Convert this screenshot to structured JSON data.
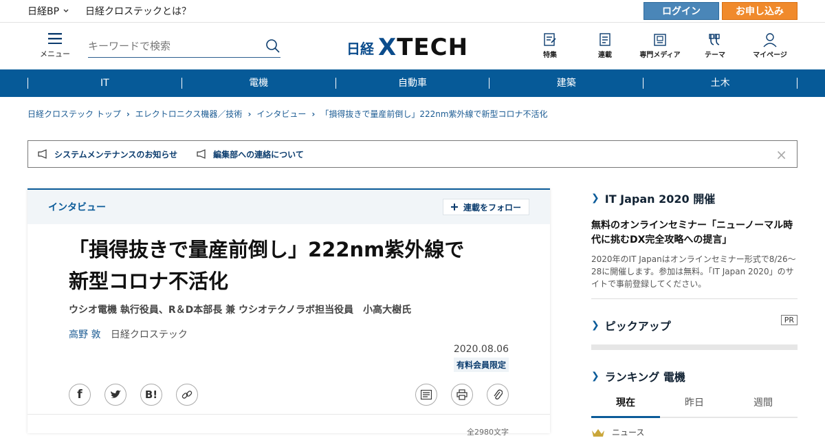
{
  "topbar": {
    "brand": "日経BP",
    "about": "日経クロステックとは？",
    "login": "ログイン",
    "signup": "お申し込み"
  },
  "header": {
    "menu_label": "メニュー",
    "search_placeholder": "キーワードで検索",
    "logo_nikkei": "日経",
    "logo_x": "X",
    "logo_tech": "TECH",
    "nav": [
      {
        "label": "特集",
        "icon": "feature-icon"
      },
      {
        "label": "連載",
        "icon": "series-icon"
      },
      {
        "label": "専門メディア",
        "icon": "media-icon"
      },
      {
        "label": "テーマ",
        "icon": "theme-icon"
      },
      {
        "label": "マイページ",
        "icon": "user-icon"
      }
    ]
  },
  "categories": [
    "IT",
    "電機",
    "自動車",
    "建築",
    "土木"
  ],
  "breadcrumb": [
    "日経クロステック トップ",
    "エレクトロニクス機器／技術",
    "インタビュー",
    "「損得抜きで量産前倒し」222nm紫外線で新型コロナ不活化"
  ],
  "notices": [
    "システムメンテナンスのお知らせ",
    "編集部への連絡について"
  ],
  "notice_close": "×",
  "article": {
    "category": "インタビュー",
    "follow": "連載をフォロー",
    "title_line1": "「損得抜きで量産前倒し」222nm紫外線で",
    "title_line2": "新型コロナ不活化",
    "subtitle": "ウシオ電機 執行役員、R＆D本部長 兼 ウシオテクノラボ担当役員　小高大樹氏",
    "author_name": "高野 敦",
    "author_org": "日経クロステック",
    "date": "2020.08.06",
    "member_only": "有料会員限定",
    "char_count": "全2980文字"
  },
  "sidebar": {
    "event_heading": "IT Japan 2020 開催",
    "promo_title": "無料のオンラインセミナー「ニューノーマル時代に挑むDX完全攻略への提言」",
    "promo_text": "2020年のIT Japanはオンラインセミナー形式で8/26～28に開催します。参加は無料。「IT Japan 2020」のサイトで事前登録してください。",
    "pickup_heading": "ピックアップ",
    "pr": "PR",
    "ranking_heading": "ランキング 電機",
    "tabs": [
      "現在",
      "昨日",
      "週間"
    ],
    "first_rank": "ニュース"
  },
  "colors": {
    "brand_blue": "#065a98",
    "login": "#4a86b8",
    "signup": "#f08a2c"
  }
}
